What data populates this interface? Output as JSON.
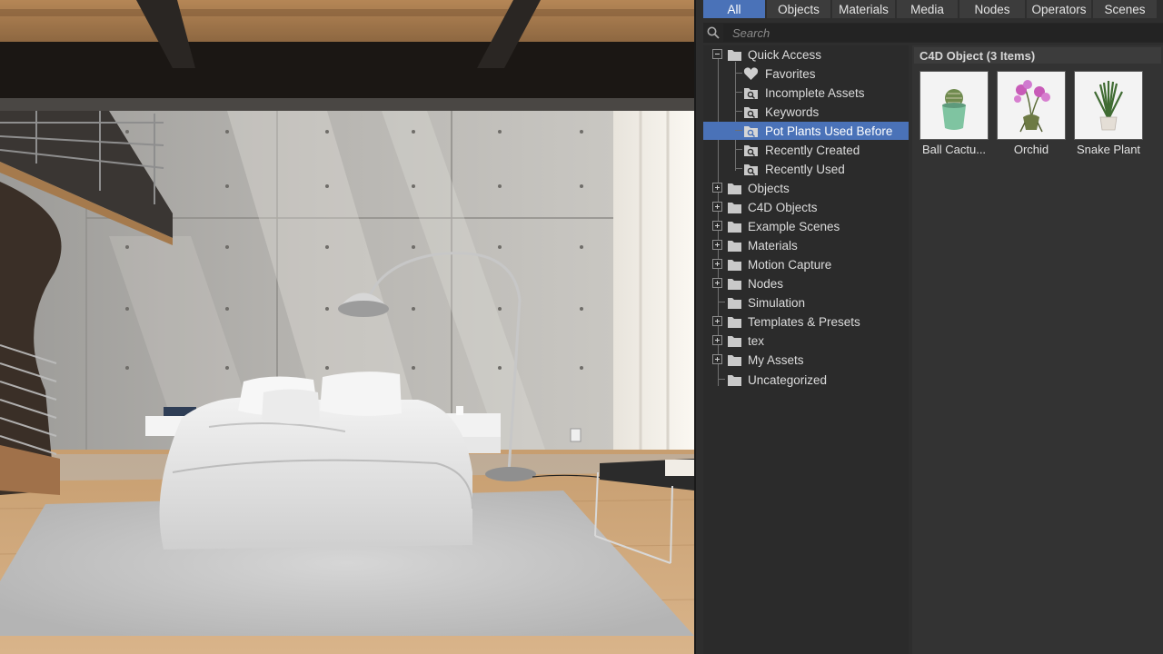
{
  "tabs": [
    {
      "label": "All",
      "active": true
    },
    {
      "label": "Objects",
      "active": false
    },
    {
      "label": "Materials",
      "active": false
    },
    {
      "label": "Media",
      "active": false
    },
    {
      "label": "Nodes",
      "active": false
    },
    {
      "label": "Operators",
      "active": false
    },
    {
      "label": "Scenes",
      "active": false
    }
  ],
  "search": {
    "placeholder": "Search",
    "value": ""
  },
  "tree": {
    "items": [
      {
        "label": "Quick Access",
        "icon": "folder-icon",
        "expander": "minus"
      },
      {
        "label": "Favorites",
        "icon": "heart-icon",
        "child": true
      },
      {
        "label": "Incomplete Assets",
        "icon": "smart-search-icon",
        "child": true
      },
      {
        "label": "Keywords",
        "icon": "smart-search-icon",
        "child": true
      },
      {
        "label": "Pot Plants Used Before",
        "icon": "smart-search-icon",
        "child": true,
        "selected": true
      },
      {
        "label": "Recently Created",
        "icon": "smart-search-icon",
        "child": true
      },
      {
        "label": "Recently Used",
        "icon": "smart-search-icon",
        "child": true
      },
      {
        "label": "Objects",
        "icon": "folder-icon",
        "expander": "plus"
      },
      {
        "label": "C4D Objects",
        "icon": "folder-icon",
        "expander": "plus"
      },
      {
        "label": "Example Scenes",
        "icon": "folder-icon",
        "expander": "plus"
      },
      {
        "label": "Materials",
        "icon": "folder-icon",
        "expander": "plus"
      },
      {
        "label": "Motion Capture",
        "icon": "folder-icon",
        "expander": "plus"
      },
      {
        "label": "Nodes",
        "icon": "folder-icon",
        "expander": "plus"
      },
      {
        "label": "Simulation",
        "icon": "folder-icon",
        "expander": "none"
      },
      {
        "label": "Templates & Presets",
        "icon": "folder-icon",
        "expander": "plus"
      },
      {
        "label": "tex",
        "icon": "folder-icon",
        "expander": "plus"
      },
      {
        "label": "My Assets",
        "icon": "folder-icon",
        "expander": "plus"
      },
      {
        "label": "Uncategorized",
        "icon": "folder-icon",
        "expander": "none"
      }
    ]
  },
  "group": {
    "header": "C4D Object (3 Items)"
  },
  "assets": [
    {
      "label": "Ball Cactu...",
      "icon": "ball-cactus-thumbnail"
    },
    {
      "label": "Orchid",
      "icon": "orchid-thumbnail"
    },
    {
      "label": "Snake Plant",
      "icon": "snake-plant-thumbnail"
    }
  ],
  "colors": {
    "accent": "#4a72b8",
    "panel": "#2e2e2e",
    "tab": "#3c3c3c"
  }
}
